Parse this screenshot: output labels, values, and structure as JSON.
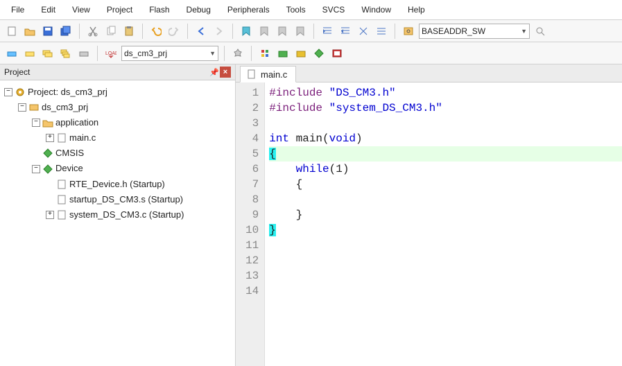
{
  "menu": {
    "items": [
      "File",
      "Edit",
      "View",
      "Project",
      "Flash",
      "Debug",
      "Peripherals",
      "Tools",
      "SVCS",
      "Window",
      "Help"
    ]
  },
  "toolbar1": {
    "combo_label": "BASEADDR_SW"
  },
  "toolbar2": {
    "target_name": "ds_cm3_prj"
  },
  "project_panel": {
    "title": "Project",
    "root": "Project: ds_cm3_prj",
    "target": "ds_cm3_prj",
    "group_app": "application",
    "file_main": "main.c",
    "group_cmsis": "CMSIS",
    "group_device": "Device",
    "file_rte": "RTE_Device.h (Startup)",
    "file_startup": "startup_DS_CM3.s (Startup)",
    "file_system": "system_DS_CM3.c (Startup)"
  },
  "editor": {
    "tab_label": "main.c",
    "lines": {
      "n1": "1",
      "n2": "2",
      "n3": "3",
      "n4": "4",
      "n5": "5",
      "n6": "6",
      "n7": "7",
      "n8": "8",
      "n9": "9",
      "n10": "10",
      "n11": "11",
      "n12": "12",
      "n13": "13",
      "n14": "14"
    },
    "code": {
      "l1_inc": "#include ",
      "l1_str": "\"DS_CM3.h\"",
      "l2_inc": "#include ",
      "l2_str": "\"system_DS_CM3.h\"",
      "l3": "",
      "l4_int": "int",
      "l4_mid": " main(",
      "l4_void": "void",
      "l4_end": ")",
      "l5": "{",
      "l6_pad": "    ",
      "l6_while": "while",
      "l6_end": "(1)",
      "l7": "    {",
      "l8": "",
      "l9": "    }",
      "l10": "}"
    }
  }
}
